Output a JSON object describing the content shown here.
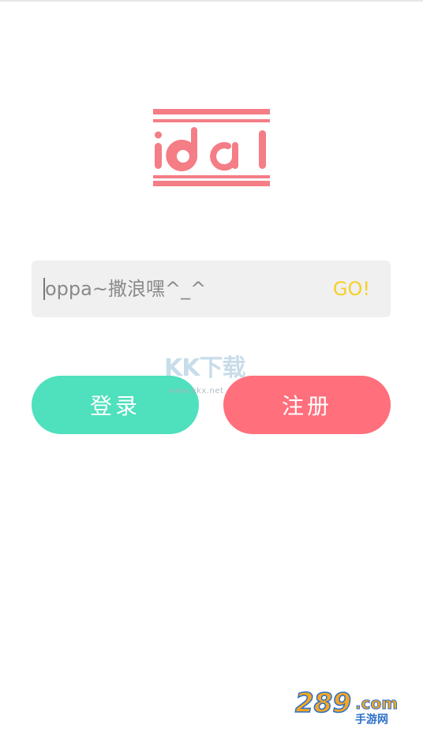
{
  "app": {
    "logo_text": "idol"
  },
  "search": {
    "placeholder": "oppa~撒浪嘿^_^",
    "go_label": "GO!"
  },
  "actions": {
    "login_label": "登录",
    "register_label": "注册"
  },
  "watermarks": {
    "kkx_text": "KK下载",
    "kkx_url": "www.kkx.net",
    "site_289_text": "289.com",
    "site_289_sub": "手游网"
  },
  "colors": {
    "logo": "#f47d86",
    "login_button": "#4fe0bd",
    "register_button": "#ff6f7c",
    "go_text": "#f5d02a",
    "input_background": "#f0f0f0"
  },
  "icons": {
    "logo": "idol-logo-icon"
  }
}
